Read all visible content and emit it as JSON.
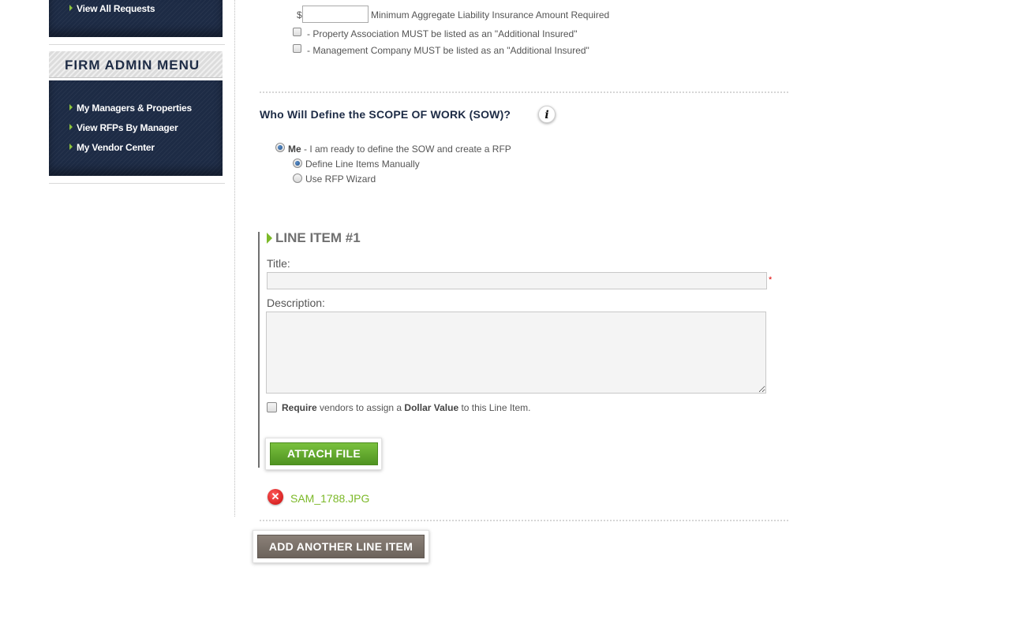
{
  "sidebar": {
    "top_items": [
      {
        "label": "View All Requests"
      }
    ],
    "admin_menu": {
      "title": "FIRM ADMIN MENU",
      "items": [
        {
          "label": "My Managers & Properties"
        },
        {
          "label": "View RFPs By Manager"
        },
        {
          "label": "My Vendor Center"
        }
      ]
    }
  },
  "insurance": {
    "currency_symbol": "$",
    "aggregate_value": "",
    "aggregate_label": "Minimum Aggregate Liability Insurance Amount Required",
    "property_assoc_label": "- Property Association MUST be listed as an \"Additional Insured\"",
    "management_co_label": "- Management Company MUST be listed as an \"Additional Insured\""
  },
  "sow": {
    "heading": "Who Will Define the SCOPE OF WORK (SOW)?",
    "info_icon": "i",
    "option_me_label": "Me",
    "option_me_desc": " - I am ready to define the SOW and create a RFP",
    "sub_options": [
      {
        "label": "Define Line Items Manually",
        "selected": true
      },
      {
        "label": "Use RFP Wizard",
        "selected": false
      }
    ]
  },
  "line_item": {
    "heading": "LINE ITEM #1",
    "title_label": "Title:",
    "title_value": "",
    "required_marker": "*",
    "description_label": "Description:",
    "description_value": "",
    "require_dollar_prefix": "Require",
    "require_dollar_mid": " vendors to assign a ",
    "require_dollar_bold": "Dollar Value",
    "require_dollar_suffix": " to this Line Item.",
    "attach_button": "ATTACH FILE",
    "attached_file": "SAM_1788.JPG",
    "delete_icon": "✕"
  },
  "actions": {
    "add_line_item": "ADD ANOTHER LINE ITEM"
  },
  "colors": {
    "navy": "#1d2b45",
    "green_accent": "#7cb928",
    "required_red": "#e00000",
    "brown_button": "#776e67"
  }
}
